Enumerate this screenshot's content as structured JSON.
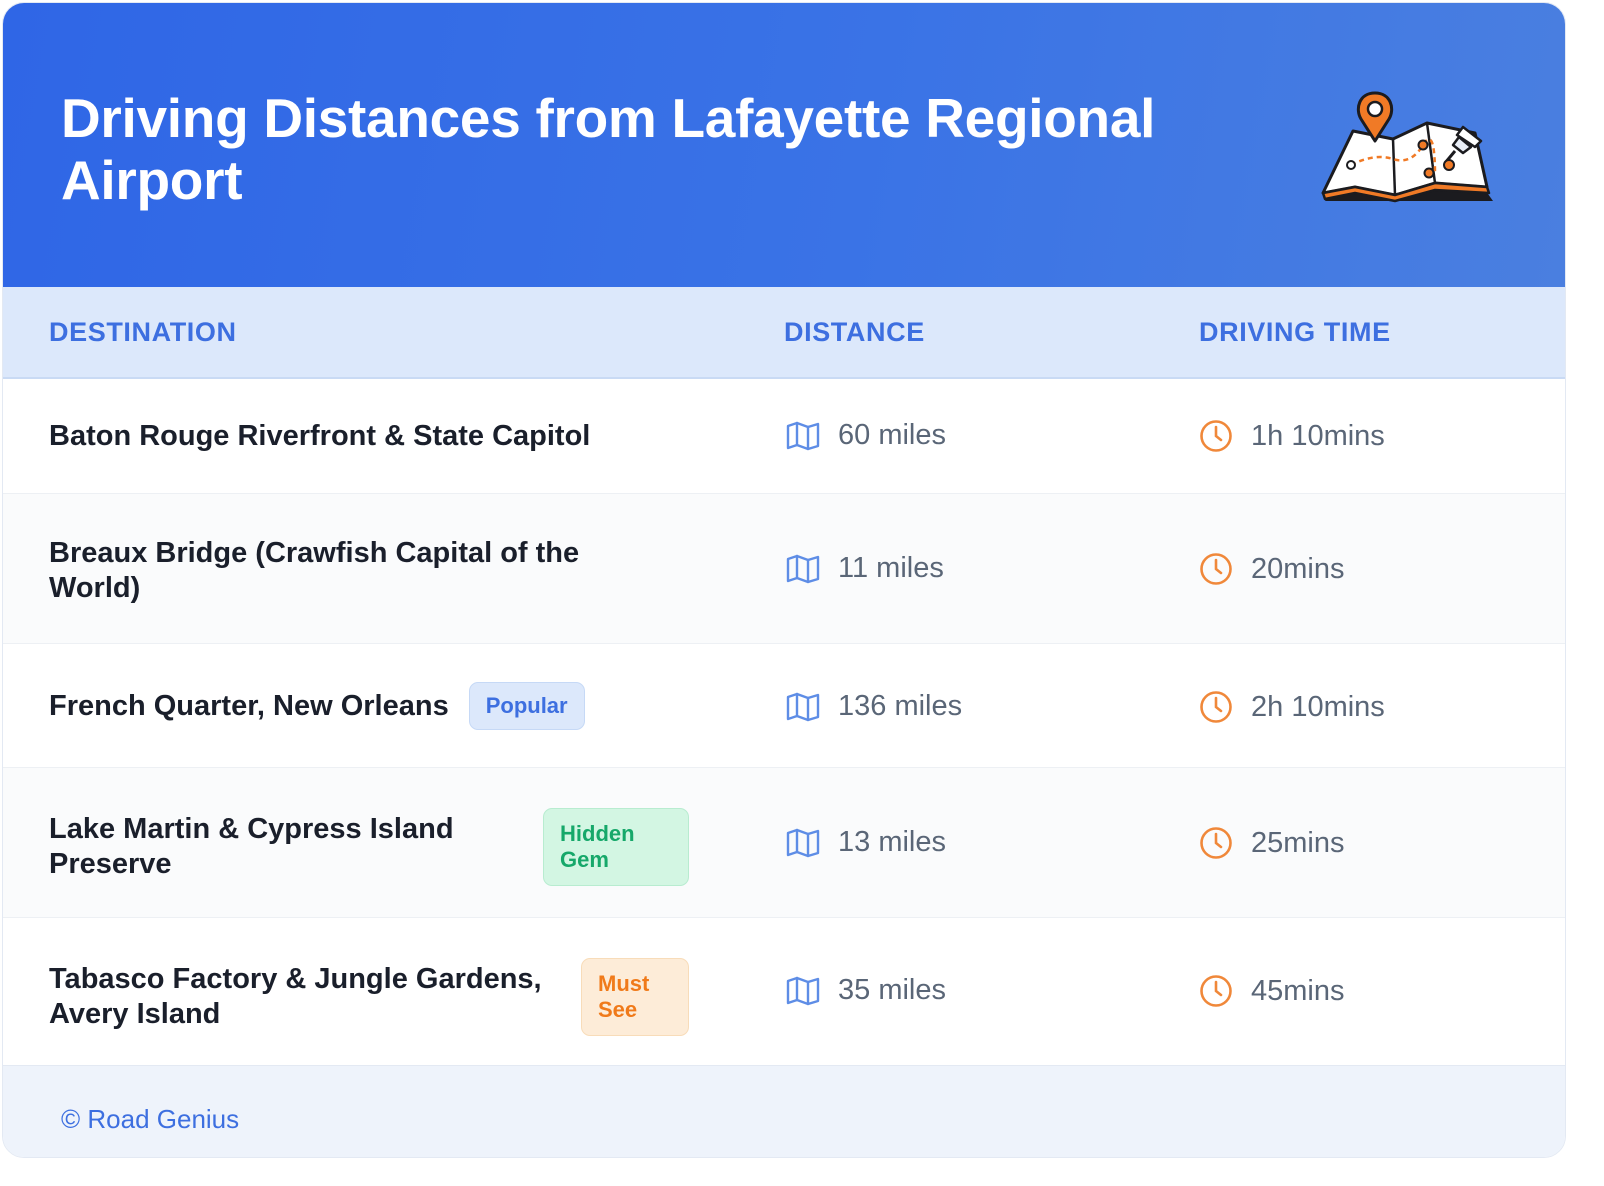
{
  "header": {
    "title": "Driving Distances from Lafayette Regional Airport",
    "illustration": "map-pin-icon"
  },
  "table": {
    "columns": [
      "DESTINATION",
      "DISTANCE",
      "DRIVING TIME"
    ],
    "rows": [
      {
        "destination": "Baton Rouge Riverfront & State Capitol",
        "badge": "",
        "distance": "60 miles",
        "time": "1h 10mins"
      },
      {
        "destination": "Breaux Bridge (Crawfish Capital of the World)",
        "badge": "",
        "distance": "11 miles",
        "time": "20mins"
      },
      {
        "destination": "French Quarter, New Orleans",
        "badge": "Popular",
        "distance": "136 miles",
        "time": "2h 10mins"
      },
      {
        "destination": "Lake Martin & Cypress Island Preserve",
        "badge": "Hidden Gem",
        "distance": "13 miles",
        "time": "25mins"
      },
      {
        "destination": "Tabasco Factory & Jungle Gardens, Avery Island",
        "badge": "Must See",
        "distance": "35 miles",
        "time": "45mins"
      }
    ]
  },
  "footer": {
    "text": "© Road Genius"
  },
  "colors": {
    "header_bg": "#3a73e6",
    "accent": "#3d6fe0",
    "clock_icon": "#f0883a",
    "badge_popular_bg": "#dce8fb",
    "badge_hidden_gem_bg": "#d3f6e3",
    "badge_must_see_bg": "#fdecd8"
  }
}
